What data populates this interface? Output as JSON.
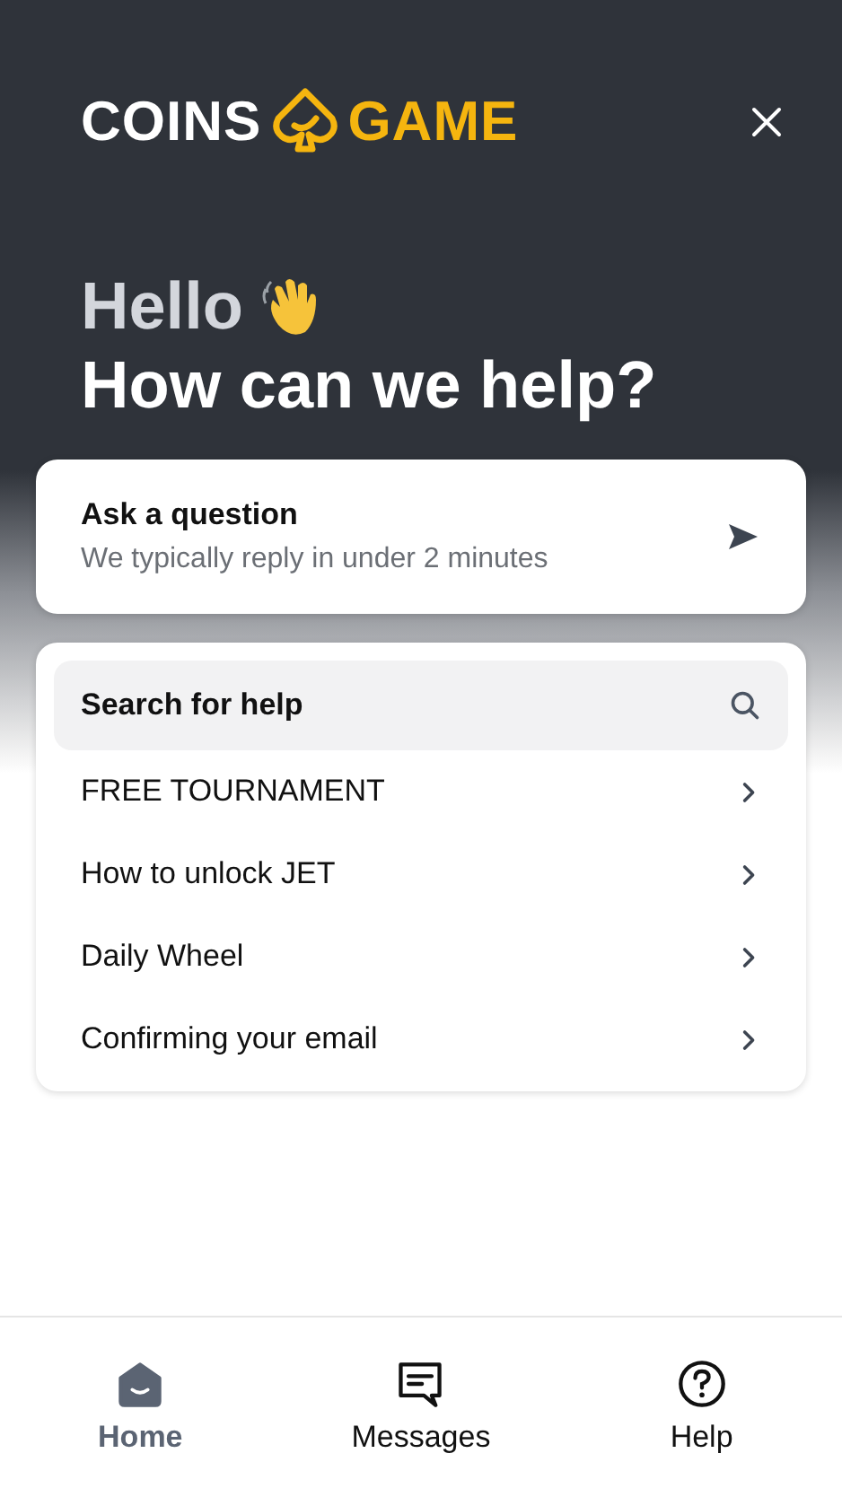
{
  "header": {
    "logo_left": "COINS",
    "logo_right": "GAME",
    "greeting": "Hello",
    "headline": "How can we help?"
  },
  "ask_card": {
    "title": "Ask a question",
    "subtitle": "We typically reply in under 2 minutes"
  },
  "search": {
    "placeholder": "Search for help"
  },
  "articles": [
    "FREE TOURNAMENT",
    "How to unlock JET",
    "Daily Wheel",
    "Confirming your email"
  ],
  "nav": [
    {
      "label": "Home",
      "kind": "home",
      "selected": true
    },
    {
      "label": "Messages",
      "kind": "messages",
      "selected": false
    },
    {
      "label": "Help",
      "kind": "help",
      "selected": false
    }
  ]
}
